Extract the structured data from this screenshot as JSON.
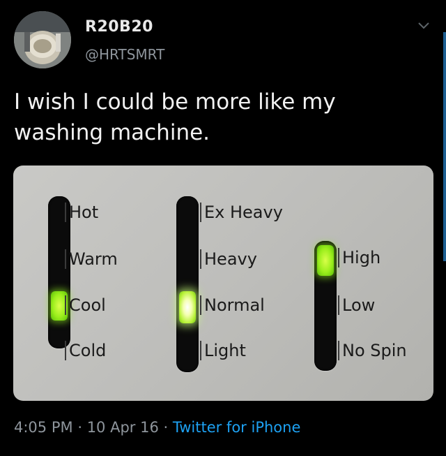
{
  "user": {
    "display_name": "R20B20",
    "handle": "@HRTSMRT",
    "avatar_icon": "avatar-photo-icon"
  },
  "tweet": {
    "text_line1": "I wish I could be more like my",
    "text_line2": "washing machine."
  },
  "media": {
    "temperature": {
      "labels": [
        "Hot",
        "Warm",
        "Cool",
        "Cold"
      ],
      "selected": "Cool"
    },
    "soil": {
      "labels": [
        "Ex Heavy",
        "Heavy",
        "Normal",
        "Light"
      ],
      "selected": "Normal"
    },
    "spin": {
      "labels": [
        "High",
        "Low",
        "No Spin"
      ],
      "selected": "High"
    },
    "colors": {
      "panel": "#c4c4c1",
      "led": "#9bee1c",
      "slot": "#0b0b0b"
    }
  },
  "meta": {
    "time": "4:05 PM",
    "separator": "·",
    "date": "10 Apr 16",
    "source": "Twitter for iPhone"
  },
  "icons": {
    "menu": "chevron-down-icon"
  },
  "colors": {
    "background": "#000000",
    "link": "#1da1f2",
    "secondary_text": "#8e959c"
  }
}
